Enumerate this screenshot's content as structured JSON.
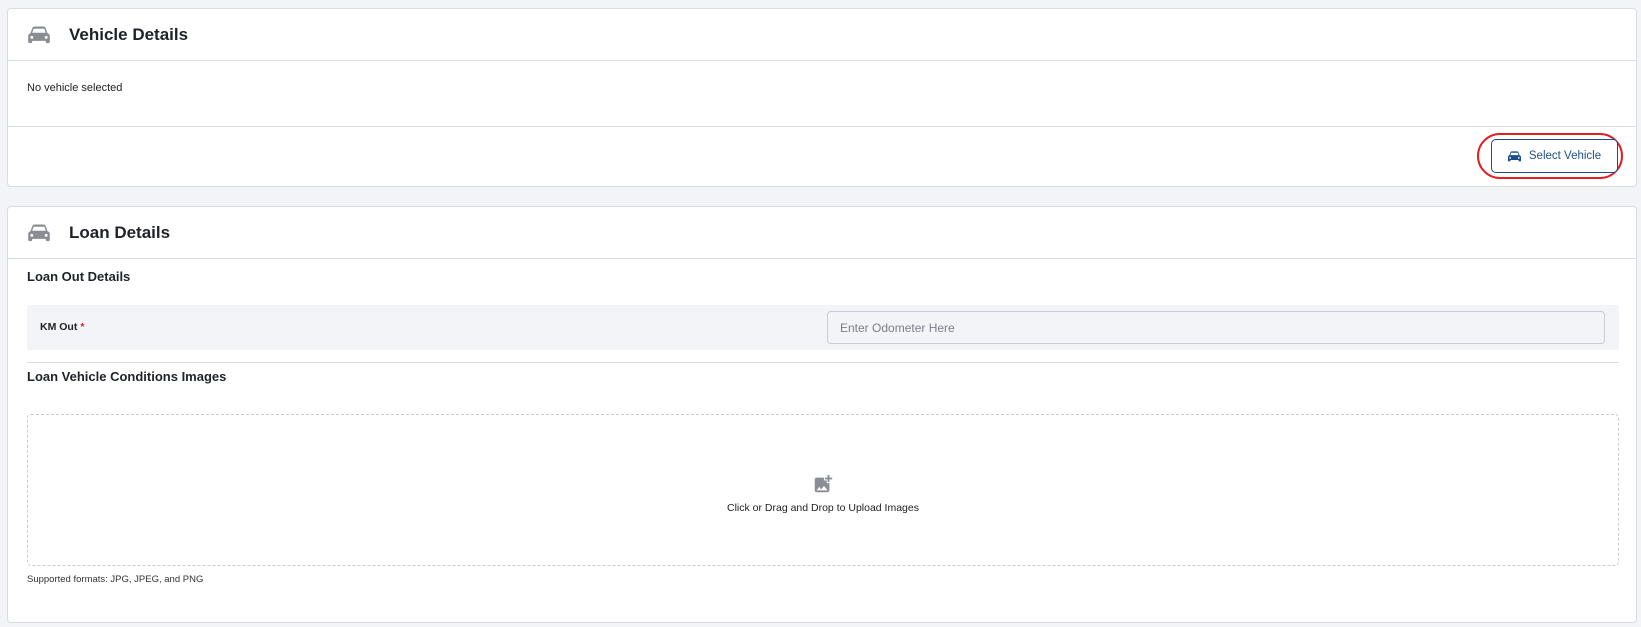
{
  "vehicle_card": {
    "title": "Vehicle Details",
    "icon": "car-icon",
    "empty_text": "No vehicle selected",
    "select_button": {
      "label": "Select Vehicle",
      "icon": "car-icon"
    }
  },
  "loan_card": {
    "title": "Loan Details",
    "icon": "car-icon",
    "loan_out": {
      "title": "Loan Out Details",
      "km_label": "KM Out",
      "required_mark": "*",
      "km_value": "",
      "km_placeholder": "Enter Odometer Here"
    },
    "images": {
      "title": "Loan Vehicle Conditions Images",
      "upload_icon": "add-image-icon",
      "upload_text": "Click or Drag and Drop to Upload Images",
      "formats_text": "Supported formats: JPG, JPEG, and PNG"
    }
  },
  "colors": {
    "accent": "#1d4e89",
    "highlight": "#e01f25",
    "icon_gray": "#8a8d93",
    "background": "#f3f4f7"
  }
}
